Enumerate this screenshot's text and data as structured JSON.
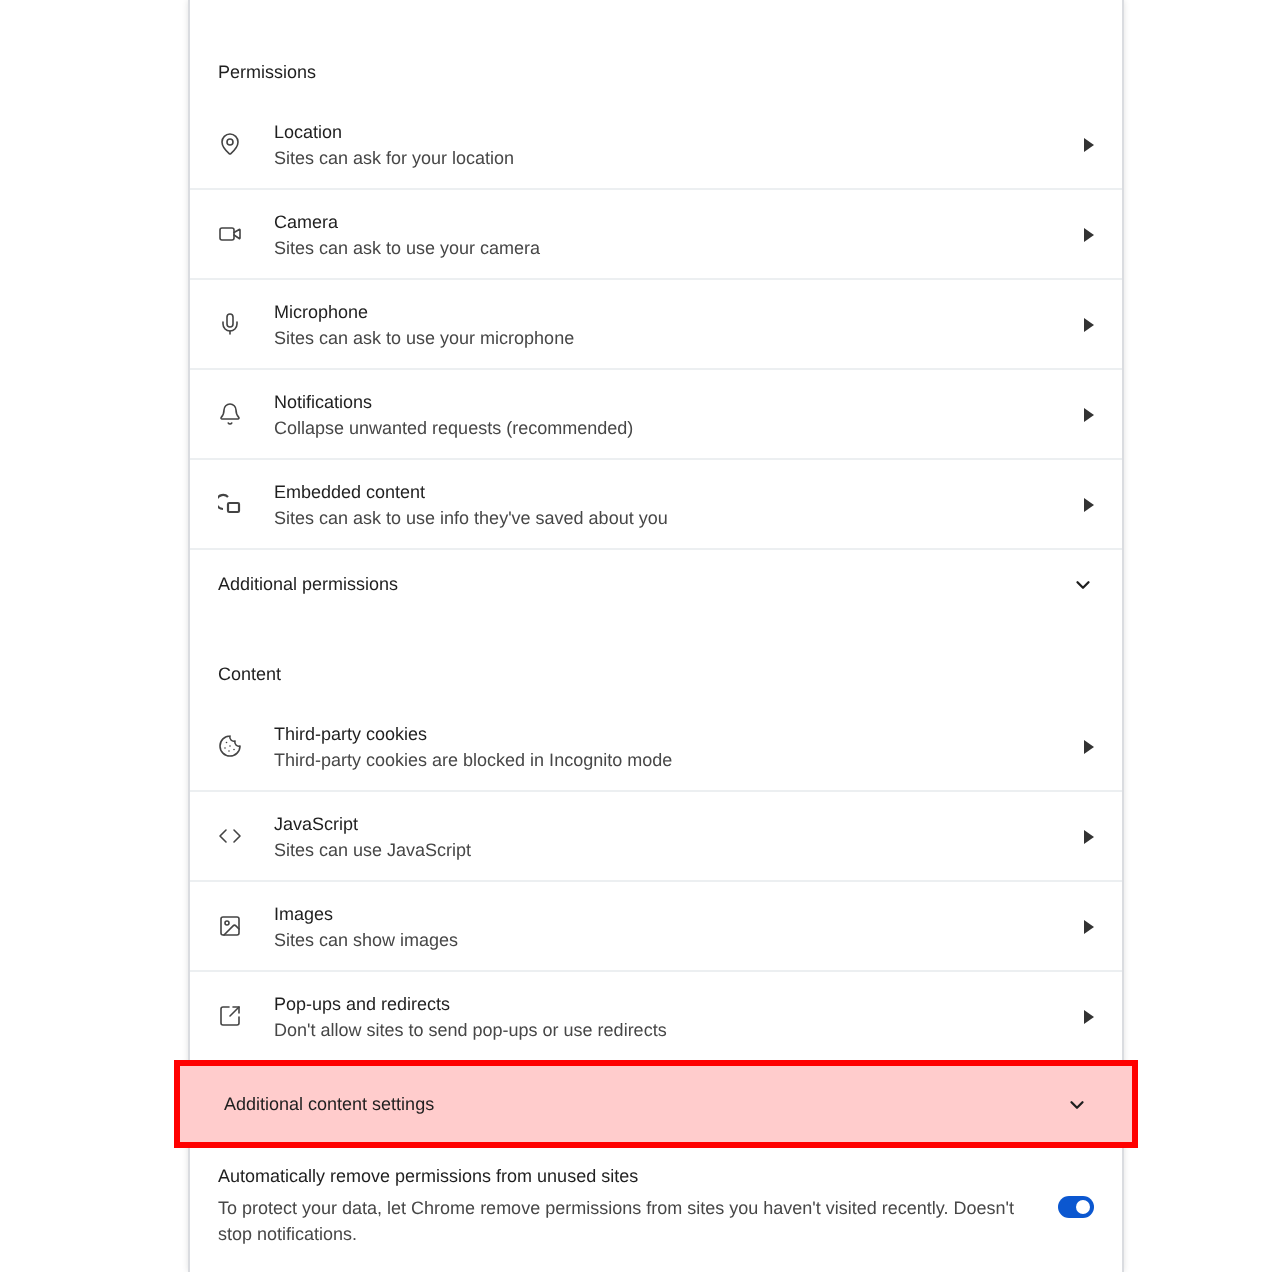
{
  "sections": [
    {
      "title": "Permissions",
      "items": [
        {
          "title": "Location",
          "subtitle": "Sites can ask for your location"
        },
        {
          "title": "Camera",
          "subtitle": "Sites can ask to use your camera"
        },
        {
          "title": "Microphone",
          "subtitle": "Sites can ask to use your microphone"
        },
        {
          "title": "Notifications",
          "subtitle": "Collapse unwanted requests (recommended)"
        },
        {
          "title": "Embedded content",
          "subtitle": "Sites can ask to use info they've saved about you"
        }
      ],
      "expander": {
        "label": "Additional permissions",
        "expanded": false,
        "highlighted": false
      }
    },
    {
      "title": "Content",
      "items": [
        {
          "title": "Third-party cookies",
          "subtitle": "Third-party cookies are blocked in Incognito mode"
        },
        {
          "title": "JavaScript",
          "subtitle": "Sites can use JavaScript"
        },
        {
          "title": "Images",
          "subtitle": "Sites can show images"
        },
        {
          "title": "Pop-ups and redirects",
          "subtitle": "Don't allow sites to send pop-ups or use redirects"
        }
      ],
      "expander": {
        "label": "Additional content settings",
        "expanded": false,
        "highlighted": true
      }
    }
  ],
  "auto_remove": {
    "title": "Automatically remove permissions from unused sites",
    "description": "To protect your data, let Chrome remove permissions from sites you haven't visited recently. Doesn't stop notifications.",
    "on": true
  }
}
